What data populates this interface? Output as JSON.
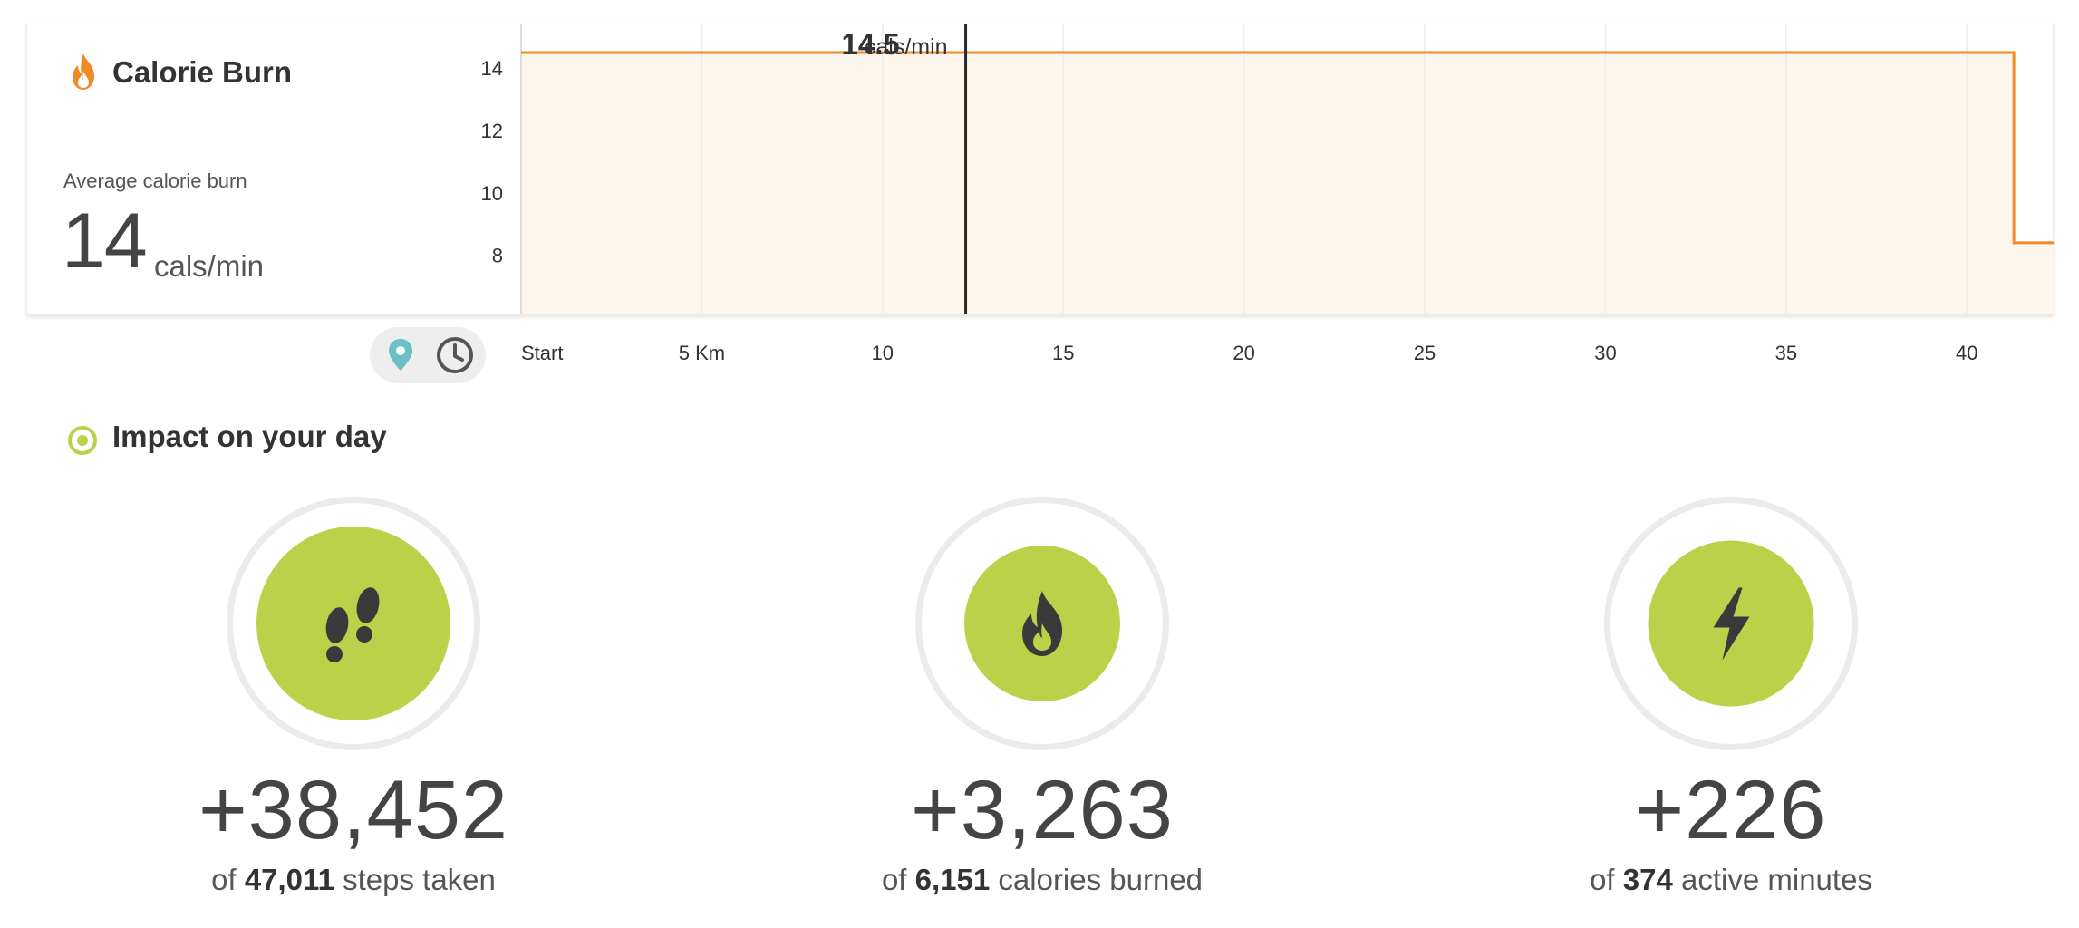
{
  "calorie_card": {
    "title": "Calorie Burn",
    "avg_label": "Average calorie burn",
    "avg_value": "14",
    "avg_unit": "cals/min",
    "cursor_value": "14.5",
    "cursor_unit": "cals/min",
    "icon": "flame-icon",
    "accent_color": "#f08a24"
  },
  "chart_data": {
    "type": "area",
    "xlabel": "",
    "ylabel": "",
    "x_ticks": [
      "Start",
      "5 Km",
      "10",
      "15",
      "20",
      "25",
      "30",
      "35",
      "40"
    ],
    "x_tick_values": [
      0,
      5,
      10,
      15,
      20,
      25,
      30,
      35,
      40
    ],
    "xlim": [
      0,
      42.4
    ],
    "y_ticks": [
      "14",
      "12",
      "10",
      "8"
    ],
    "y_tick_values": [
      14,
      12,
      10,
      8
    ],
    "ylim": [
      6.1,
      15.4
    ],
    "series": [
      {
        "x": [
          0,
          41.3,
          41.3,
          42.4
        ],
        "y": [
          14.5,
          14.5,
          8.4,
          8.4
        ]
      }
    ],
    "cursor_x": 12.3,
    "cursor_y": 14.5,
    "grid": "vertical",
    "line_color": "#f08a24",
    "fill_color": "#fdf6ec"
  },
  "axis_toggle": {
    "options": [
      "location-pin-icon",
      "clock-icon"
    ],
    "selected": "location-pin-icon"
  },
  "impact": {
    "title": "Impact on your day",
    "icon": "target-icon",
    "stats": [
      {
        "icon": "footsteps-icon",
        "delta": "+38,452",
        "prefix": "of ",
        "total": "47,011",
        "suffix": " steps taken",
        "fill_fraction": 0.82
      },
      {
        "icon": "flame-icon",
        "delta": "+3,263",
        "prefix": "of ",
        "total": "6,151",
        "suffix": " calories burned",
        "fill_fraction": 0.53
      },
      {
        "icon": "lightning-icon",
        "delta": "+226",
        "prefix": "of ",
        "total": "374",
        "suffix": " active minutes",
        "fill_fraction": 0.6
      }
    ],
    "accent_color": "#bcd14a"
  }
}
